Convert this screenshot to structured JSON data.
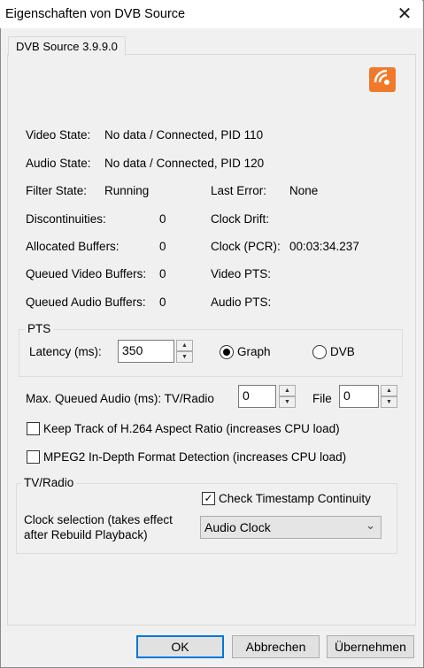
{
  "window": {
    "title": "Eigenschaften von DVB Source",
    "close_glyph": "✕"
  },
  "tab": {
    "label": "DVB Source 3.9.9.0"
  },
  "logo": {
    "icon": "rss-feed-icon",
    "color": "#f07a2a"
  },
  "status": {
    "video_state_label": "Video State:",
    "video_state_value": "No data / Connected, PID 110",
    "audio_state_label": "Audio State:",
    "audio_state_value": "No data / Connected, PID 120",
    "filter_state_label": "Filter State:",
    "filter_state_value": "Running",
    "last_error_label": "Last Error:",
    "last_error_value": "None",
    "discontinuities_label": "Discontinuities:",
    "discontinuities_value": "0",
    "clock_drift_label": "Clock Drift:",
    "allocated_buffers_label": "Allocated Buffers:",
    "allocated_buffers_value": "0",
    "clock_pcr_label": "Clock (PCR):",
    "clock_pcr_value": "00:03:34.237",
    "queued_video_label": "Queued Video Buffers:",
    "queued_video_value": "0",
    "video_pts_label": "Video PTS:",
    "queued_audio_label": "Queued Audio Buffers:",
    "queued_audio_value": "0",
    "audio_pts_label": "Audio PTS:"
  },
  "pts": {
    "group_title": "PTS",
    "latency_label": "Latency (ms):",
    "latency_value": "350",
    "radio_graph": "Graph",
    "radio_dvb": "DVB",
    "selected": "Graph"
  },
  "queued_audio": {
    "label": "Max. Queued Audio (ms): TV/Radio",
    "tvradio_value": "0",
    "file_label": "File",
    "file_value": "0"
  },
  "options": {
    "h264_aspect": "Keep Track of H.264 Aspect Ratio (increases CPU load)",
    "h264_checked": false,
    "mpeg2_detect": "MPEG2 In-Depth Format Detection (increases CPU load)",
    "mpeg2_checked": false
  },
  "tvradio": {
    "group_title": "TV/Radio",
    "timestamp_label": "Check Timestamp Continuity",
    "timestamp_checked": true,
    "check_glyph": "✓",
    "clock_label_line1": "Clock selection (takes effect",
    "clock_label_line2": "after Rebuild Playback)",
    "clock_value": "Audio Clock",
    "chevron": "⌄"
  },
  "buttons": {
    "ok": "OK",
    "cancel": "Abbrechen",
    "apply": "Übernehmen"
  },
  "spin_glyphs": {
    "up": "▲",
    "down": "▼"
  }
}
